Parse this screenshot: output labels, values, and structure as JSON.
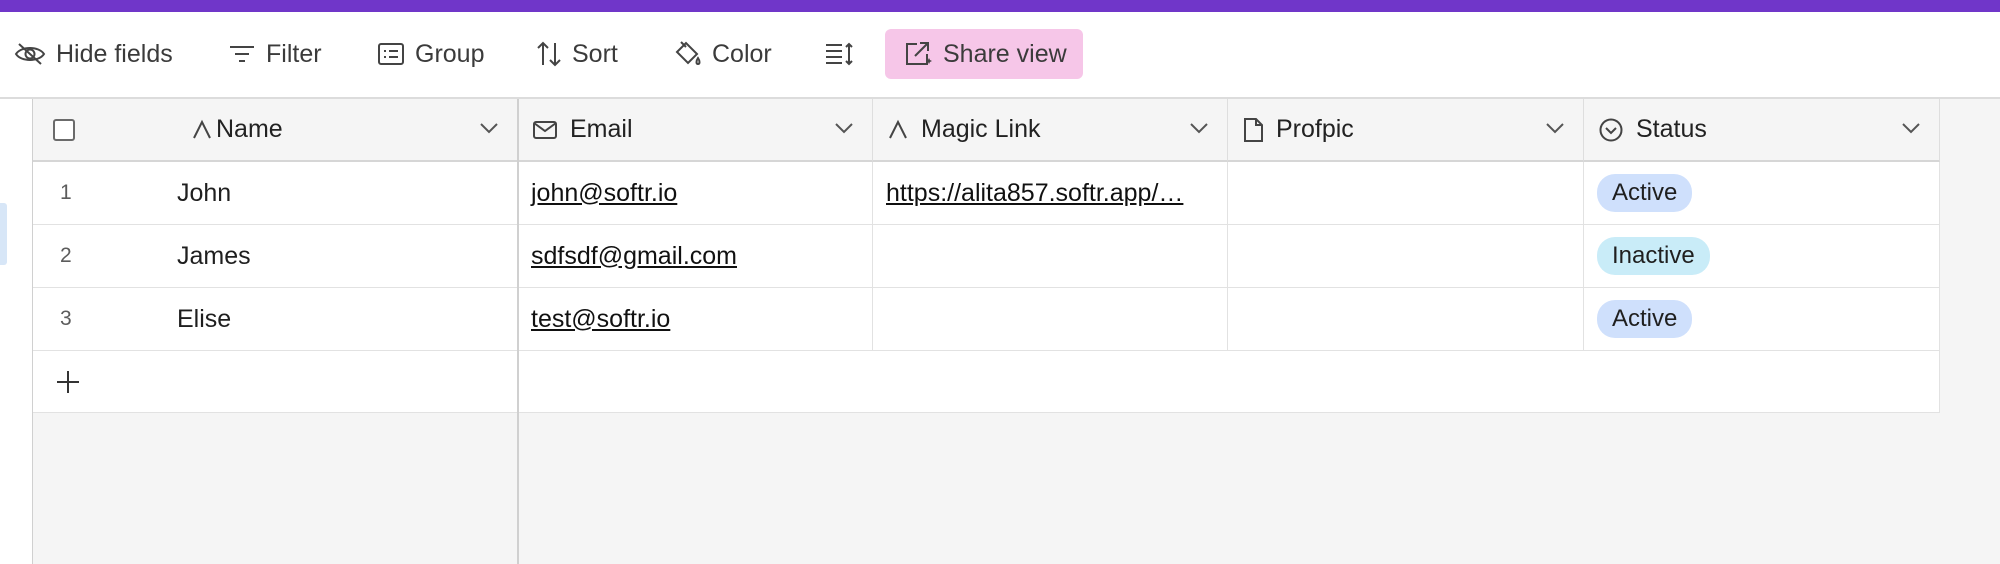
{
  "toolbar": {
    "hide_fields": "Hide fields",
    "filter": "Filter",
    "group": "Group",
    "sort": "Sort",
    "color": "Color",
    "share_view": "Share view"
  },
  "columns": [
    {
      "label": "Name",
      "icon": "text-a-icon"
    },
    {
      "label": "Email",
      "icon": "email-icon"
    },
    {
      "label": "Magic Link",
      "icon": "text-a-icon"
    },
    {
      "label": "Profpic",
      "icon": "file-icon"
    },
    {
      "label": "Status",
      "icon": "single-select-icon"
    }
  ],
  "rows": [
    {
      "num": "1",
      "name": "John",
      "email": "john@softr.io",
      "magic_link": "https://alita857.softr.app/…",
      "profpic": "",
      "status": "Active"
    },
    {
      "num": "2",
      "name": "James",
      "email": "sdfsdf@gmail.com",
      "magic_link": "",
      "profpic": "",
      "status": "Inactive"
    },
    {
      "num": "3",
      "name": "Elise",
      "email": "test@softr.io",
      "magic_link": "",
      "profpic": "",
      "status": "Active"
    }
  ],
  "colors": {
    "topbar": "#7036c9",
    "share_bg": "#f6c6e8",
    "active_badge": "#cfe0fc",
    "inactive_badge": "#c9ecf8"
  }
}
